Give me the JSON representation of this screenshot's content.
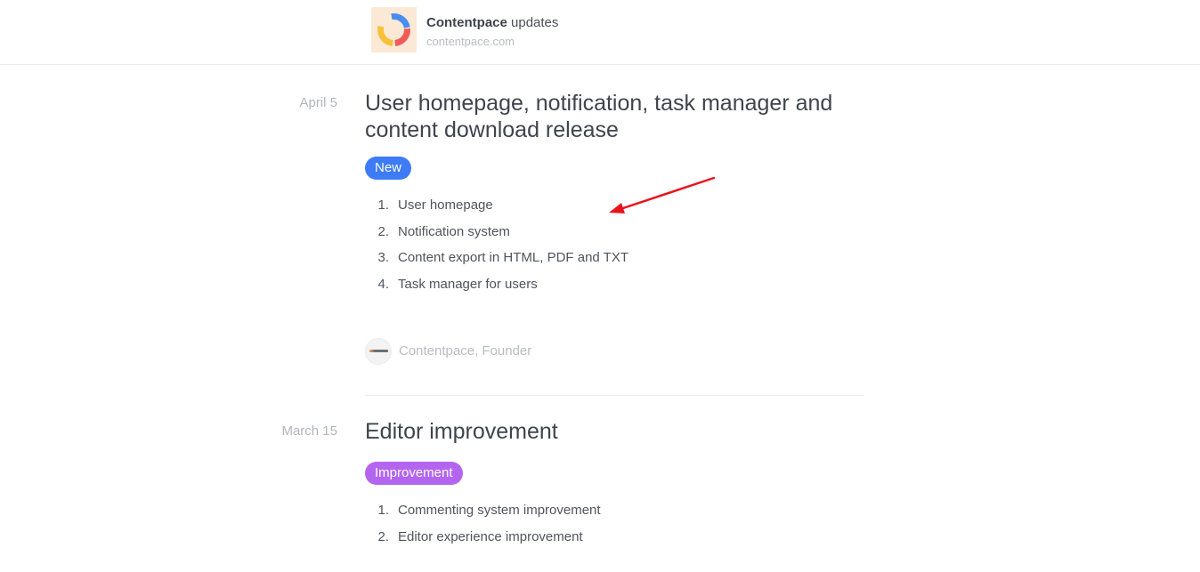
{
  "header": {
    "brand_name": "Contentpace",
    "brand_suffix": " updates",
    "domain": "contentpace.com",
    "logo_icon": "contentpace-ring-logo"
  },
  "entries": [
    {
      "date": "April 5",
      "title": "User homepage, notification, task manager and content download release",
      "badge": {
        "label": "New",
        "color": "#3e7bf6"
      },
      "items": [
        {
          "num": "1.",
          "text": "User homepage"
        },
        {
          "num": "2.",
          "text": "Notification system"
        },
        {
          "num": "3.",
          "text": "Content export in HTML, PDF and TXT"
        },
        {
          "num": "4.",
          "text": "Task manager for users"
        }
      ],
      "author": "Contentpace, Founder"
    },
    {
      "date": "March 15",
      "title": "Editor improvement",
      "badge": {
        "label": "Improvement",
        "color": "#b465f0"
      },
      "items": [
        {
          "num": "1.",
          "text": "Commenting system improvement"
        },
        {
          "num": "2.",
          "text": "Editor experience improvement"
        }
      ]
    }
  ],
  "annotation": {
    "arrow_color": "#e8141c"
  }
}
